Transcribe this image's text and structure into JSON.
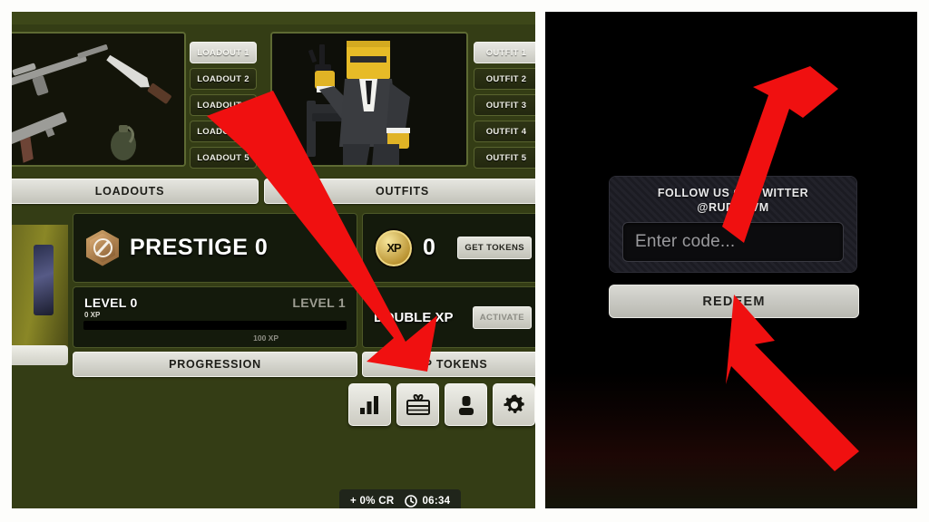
{
  "colors": {
    "background_green": "#343d15",
    "panel_dark": "#141a0c",
    "accent_red": "#f01010",
    "button_light": "#d9d9d4",
    "gold": "#c8a526"
  },
  "left_panel": {
    "name": "game-lobby",
    "loadout_slots": [
      {
        "label": "LOADOUT 1",
        "active": true
      },
      {
        "label": "LOADOUT 2",
        "active": false
      },
      {
        "label": "LOADOUT 3",
        "active": false
      },
      {
        "label": "LOADOUT 4",
        "active": false
      },
      {
        "label": "LOADOUT 5",
        "active": false
      }
    ],
    "outfit_slots": [
      {
        "label": "OUTFIT 1",
        "active": true
      },
      {
        "label": "OUTFIT 2",
        "active": false
      },
      {
        "label": "OUTFIT 3",
        "active": false
      },
      {
        "label": "OUTFIT 4",
        "active": false
      },
      {
        "label": "OUTFIT 5",
        "active": false
      }
    ],
    "tabs": {
      "loadouts": "LOADOUTS",
      "outfits": "OUTFITS",
      "progression": "PROGRESSION",
      "xp_tokens": "XP TOKENS"
    },
    "prestige": {
      "label": "PRESTIGE 0",
      "badge_icon": "prestige-hex-icon"
    },
    "xp_tokens": {
      "coin_label": "XP",
      "count": "0",
      "get_tokens_label": "GET TOKENS"
    },
    "level": {
      "current": "LEVEL 0",
      "next": "LEVEL 1",
      "xp_value": "0 XP",
      "goal": "100 XP",
      "progress_percent": 0
    },
    "double_xp": {
      "label": "DOUBLE XP",
      "activate_label": "ACTIVATE"
    },
    "icon_buttons": [
      {
        "icon": "stats-bar-chart-icon",
        "name": "stats-button"
      },
      {
        "icon": "gift-card-icon",
        "name": "redeem-code-button"
      },
      {
        "icon": "person-profile-icon",
        "name": "profile-button"
      },
      {
        "icon": "gear-settings-icon",
        "name": "settings-button"
      }
    ],
    "status_bar": {
      "cr_bonus": "+ 0% CR",
      "clock_icon": "clock-icon",
      "time": "06:34"
    }
  },
  "right_panel": {
    "name": "code-redeem-screen",
    "follow_line1": "FOLLOW US ON TWITTER",
    "follow_line2": "@RUDDEVM",
    "code_placeholder": "Enter code...",
    "code_value": "",
    "redeem_label": "REDEEM"
  },
  "annotations": {
    "arrow_count": 3,
    "color": "#f01010"
  }
}
